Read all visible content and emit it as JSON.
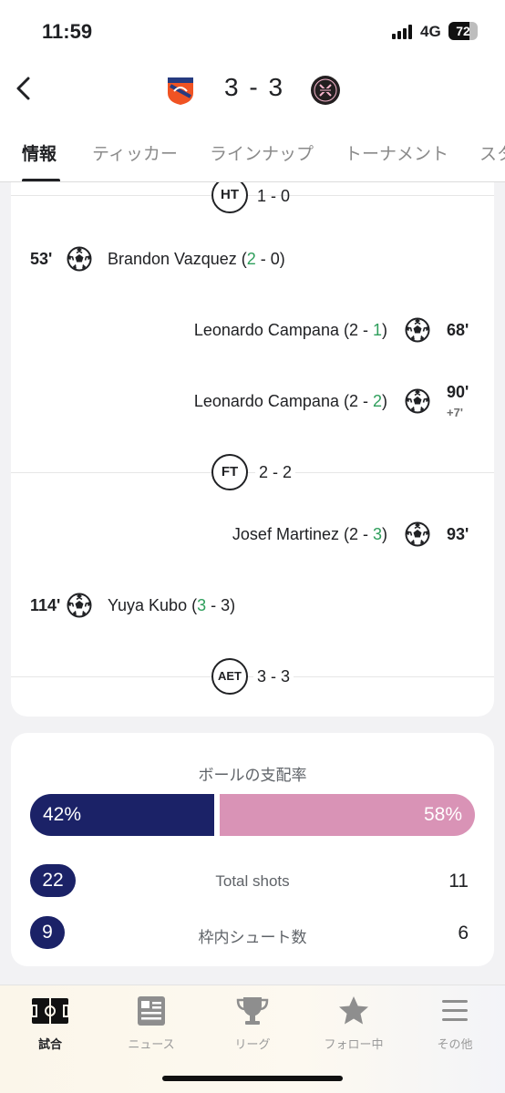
{
  "status_bar": {
    "time": "11:59",
    "network": "4G",
    "battery": "72",
    "battery_level": 0.72
  },
  "match": {
    "home_team_icon": "fc-cincinnati-crest-icon",
    "away_team_icon": "inter-miami-crest-icon",
    "score": "3 - 3"
  },
  "tabs": [
    "情報",
    "ティッカー",
    "ラインナップ",
    "トーナメント",
    "スタ"
  ],
  "active_tab": 0,
  "events": {
    "ht": {
      "badge": "HT",
      "score": "1 - 0"
    },
    "goal1": {
      "minute": "53'",
      "player": "Brandon Vazquez",
      "score_pre": " (",
      "score_home": "2",
      "score_mid": " - 0)"
    },
    "goal2": {
      "minute": "68'",
      "player": "Leonardo Campana",
      "score_pre": " (2 - ",
      "score_away": "1",
      "score_post": ")"
    },
    "goal3": {
      "minute": "90'",
      "extra": "+7'",
      "player": "Leonardo Campana",
      "score_pre": " (2 - ",
      "score_away": "2",
      "score_post": ")"
    },
    "ft": {
      "badge": "FT",
      "score": "2 - 2"
    },
    "goal4": {
      "minute": "93'",
      "player": "Josef Martinez",
      "score_pre": " (2 - ",
      "score_away": "3",
      "score_post": ")"
    },
    "goal5": {
      "minute": "114'",
      "player": "Yuya Kubo",
      "score_pre": " (",
      "score_home": "3",
      "score_mid": " - 3)"
    },
    "aet": {
      "badge": "AET",
      "score": "3 - 3"
    }
  },
  "stats": {
    "possession_title": "ボールの支配率",
    "possession_home": "42%",
    "possession_away": "58%",
    "possession_home_value": 42,
    "total_shots": {
      "label": "Total shots",
      "home": "22",
      "away": "11"
    },
    "shots_on_target": {
      "label": "枠内シュート数",
      "home": "9",
      "away": "6"
    }
  },
  "colors": {
    "home": "#1b2267",
    "away": "#d993b6",
    "goal_highlight": "#2e9e5b"
  },
  "bottom_nav": [
    {
      "label": "試合",
      "icon": "pitch-icon"
    },
    {
      "label": "ニュース",
      "icon": "news-icon"
    },
    {
      "label": "リーグ",
      "icon": "trophy-icon"
    },
    {
      "label": "フォロー中",
      "icon": "star-icon"
    },
    {
      "label": "その他",
      "icon": "menu-icon"
    }
  ]
}
